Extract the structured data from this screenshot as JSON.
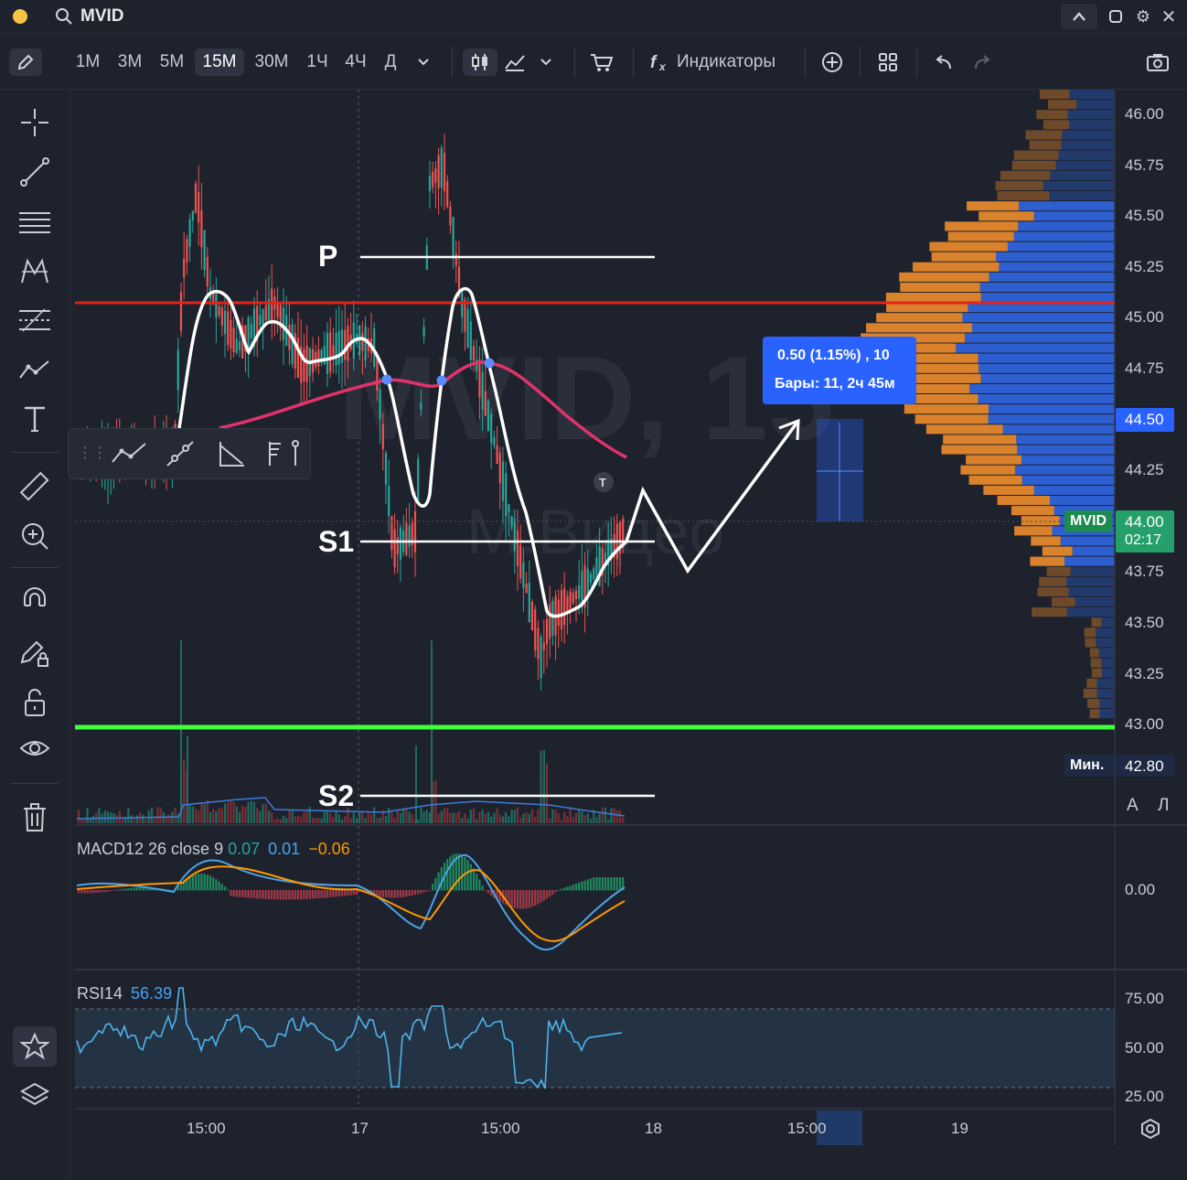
{
  "title_bar": {
    "symbol": "MVID"
  },
  "toolbar": {
    "timeframes": [
      "1М",
      "3М",
      "5М",
      "15М",
      "30М",
      "1Ч",
      "4Ч",
      "Д"
    ],
    "active_timeframe": "15М",
    "indicators_label": "Индикаторы"
  },
  "chart": {
    "watermark_symbol": "MVID, 15",
    "watermark_name": "М.Видео",
    "price_axis": [
      "46.00",
      "45.75",
      "45.50",
      "45.25",
      "45.00",
      "44.75",
      "44.50",
      "44.25",
      "44.00",
      "43.75",
      "43.50",
      "43.25",
      "43.00"
    ],
    "price_highlight_level": "44.50",
    "current_price": "44.00",
    "current_symbol_tag": "MVID",
    "countdown": "02:17",
    "min_label": "Мин.",
    "min_value": "42.80",
    "axis_mode_a": "A",
    "axis_mode_l": "Л",
    "time_axis": [
      "15:00",
      "17",
      "15:00",
      "18",
      "15:00",
      "19"
    ],
    "annotations": {
      "pivot": "P",
      "support1": "S1",
      "support2": "S2",
      "event_marker": "T"
    },
    "measure_tooltip": {
      "line1": "0.50 (1.15%) , 10",
      "line2": "Бары: 11, 2ч 45м"
    },
    "colors": {
      "resistance_line": "#e2231a",
      "support_line": "#3fff3f",
      "ma_line": "#e0336b",
      "volume_profile_up": "#2e5fd0",
      "volume_profile_down": "#d9822b",
      "highlight": "#2962ff"
    }
  },
  "macd": {
    "label": "MACD12 26 close 9",
    "v1": "0.07",
    "v2": "0.01",
    "v3": "−0.06",
    "axis_zero": "0.00"
  },
  "rsi": {
    "label": "RSI14",
    "value": "56.39",
    "axis": [
      "75.00",
      "50.00",
      "25.00"
    ]
  }
}
